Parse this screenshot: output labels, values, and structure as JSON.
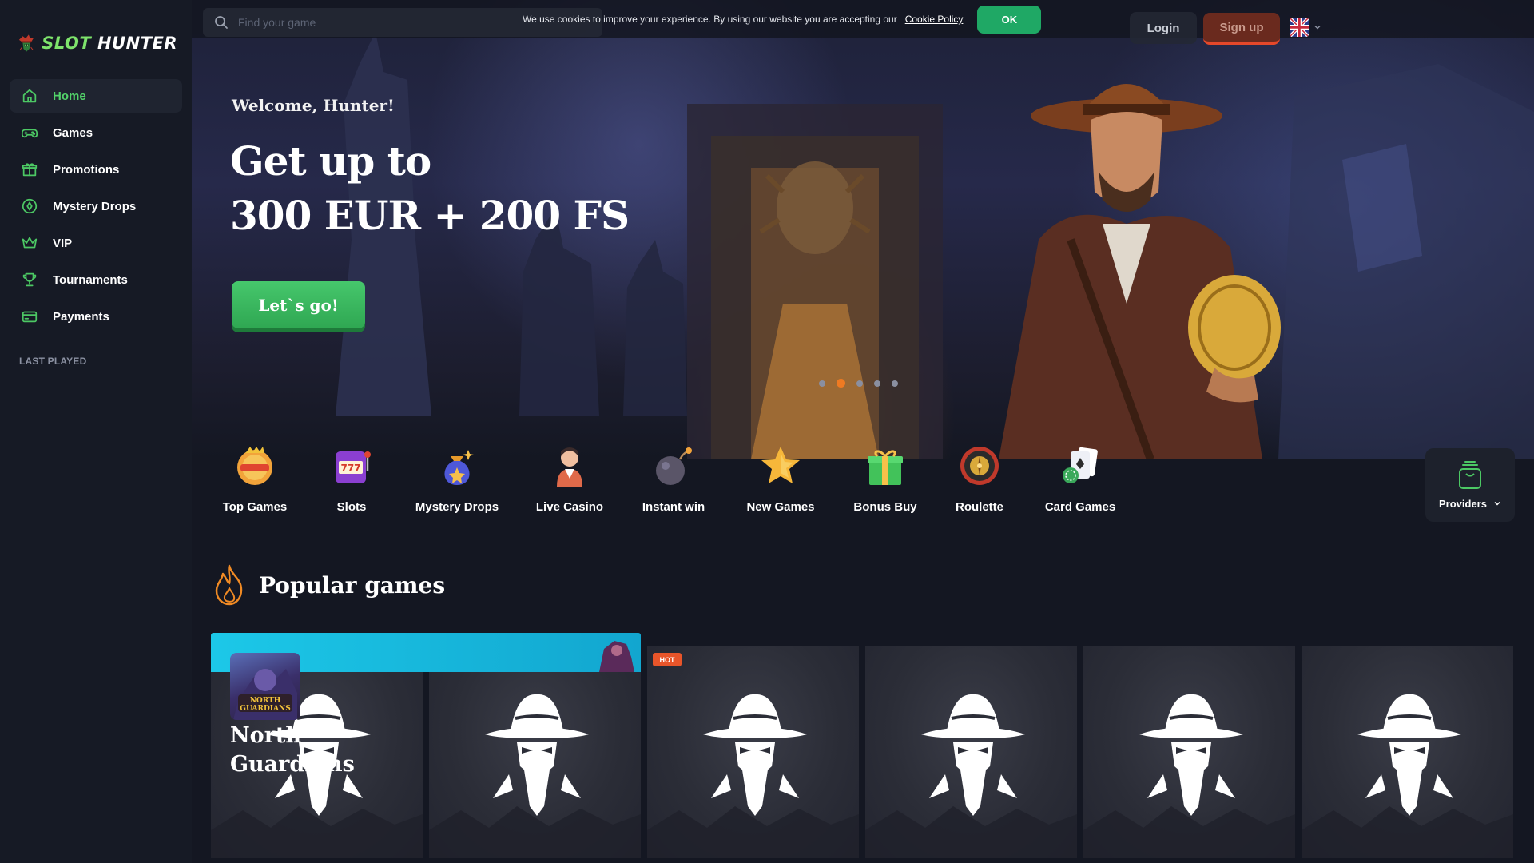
{
  "brand": {
    "name_part1": "SLOT",
    "name_part2": "HUNTER"
  },
  "sidebar": {
    "items": [
      {
        "label": "Home",
        "icon": "home-icon",
        "active": true
      },
      {
        "label": "Games",
        "icon": "gamepad-icon",
        "active": false
      },
      {
        "label": "Promotions",
        "icon": "gift-icon",
        "active": false
      },
      {
        "label": "Mystery Drops",
        "icon": "mystery-drops-icon",
        "active": false
      },
      {
        "label": "VIP",
        "icon": "crown-icon",
        "active": false
      },
      {
        "label": "Tournaments",
        "icon": "trophy-icon",
        "active": false
      },
      {
        "label": "Payments",
        "icon": "card-icon",
        "active": false
      }
    ],
    "last_played_label": "LAST PLAYED"
  },
  "header": {
    "search_placeholder": "Find your game",
    "cookie_text": "We use cookies to improve your experience. By using our website you are accepting our",
    "cookie_link": "Cookie Policy",
    "cookie_ok": "OK",
    "login": "Login",
    "signup": "Sign up",
    "language_icon": "uk-flag-icon"
  },
  "hero": {
    "welcome": "Welcome, Hunter!",
    "headline_line1": "Get up to",
    "headline_line2": "300 EUR + 200 FS",
    "cta": "Let`s go!",
    "slide_count": 5,
    "active_slide": 2
  },
  "categories": [
    {
      "label": "Top Games",
      "icon": "casino-chip-icon"
    },
    {
      "label": "Slots",
      "icon": "slot-machine-icon"
    },
    {
      "label": "Mystery Drops",
      "icon": "money-bag-icon"
    },
    {
      "label": "Live Casino",
      "icon": "dealer-icon"
    },
    {
      "label": "Instant win",
      "icon": "bomb-icon"
    },
    {
      "label": "New Games",
      "icon": "star-icon"
    },
    {
      "label": "Bonus Buy",
      "icon": "gift-box-icon"
    },
    {
      "label": "Roulette",
      "icon": "roulette-icon"
    },
    {
      "label": "Card Games",
      "icon": "cards-icon"
    }
  ],
  "providers": {
    "label": "Providers"
  },
  "popular": {
    "title": "Popular games",
    "featured_game": "North Guardians",
    "featured_thumb_text": "NORTH GUARDIANS",
    "hot_badge": "HOT",
    "tiles": 6
  },
  "colors": {
    "accent_green": "#52d36a",
    "signup_red": "#e5482a",
    "slide_active": "#ef7a22",
    "cookie_ok": "#1fa865"
  }
}
